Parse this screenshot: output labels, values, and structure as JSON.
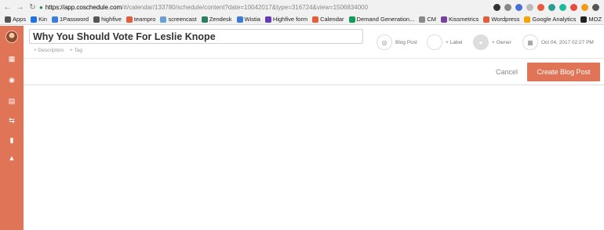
{
  "browser": {
    "url_host": "https://app.coschedule.com",
    "url_rest": "/#/calendar/133780/schedule/content?date=10042017&type=316724&view=1506834000"
  },
  "bookmarks": [
    {
      "label": "Apps",
      "color": "#555"
    },
    {
      "label": "Kin",
      "color": "#1a73e8"
    },
    {
      "label": "1Password",
      "color": "#3b7ddd"
    },
    {
      "label": "highfive",
      "color": "#555"
    },
    {
      "label": "teampro",
      "color": "#e45c3a"
    },
    {
      "label": "screencast",
      "color": "#6aa0d8"
    },
    {
      "label": "Zendesk",
      "color": "#2a7f62"
    },
    {
      "label": "Wistia",
      "color": "#3a7bd5"
    },
    {
      "label": "Highfive form",
      "color": "#673ab7"
    },
    {
      "label": "Calendar",
      "color": "#e45c3a"
    },
    {
      "label": "Demand Generation...",
      "color": "#0f9d58"
    },
    {
      "label": "CM",
      "color": "#888"
    },
    {
      "label": "Kissmetrics",
      "color": "#7b3fa0"
    },
    {
      "label": "Wordpress",
      "color": "#e45c3a"
    },
    {
      "label": "Google Analytics",
      "color": "#f4a300"
    },
    {
      "label": "MOZ",
      "color": "#222"
    }
  ],
  "post": {
    "title": "Why You Should Vote For Leslie Knope",
    "add_description": "+ Description",
    "add_tag": "+ Tag"
  },
  "meta": {
    "type_label": "Blog Post",
    "label_label": "+ Label",
    "owner_label": "+ Owner",
    "date_label": "Oct 04, 2017 02:27 PM"
  },
  "actions": {
    "cancel": "Cancel",
    "create": "Create Blog Post"
  },
  "colors": {
    "accent": "#e07457"
  }
}
